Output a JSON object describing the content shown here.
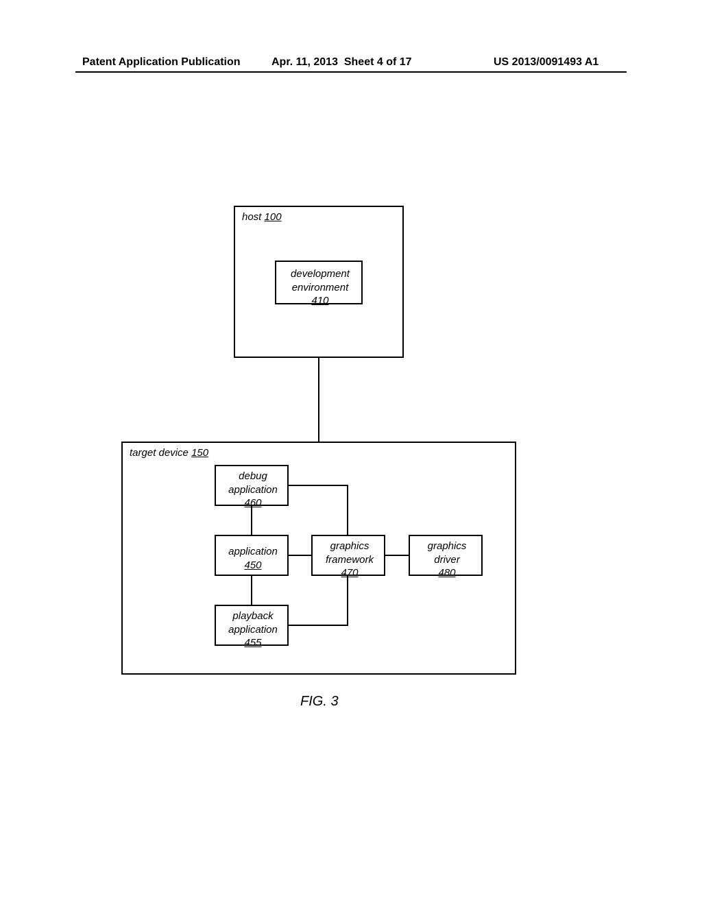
{
  "header": {
    "left": "Patent Application Publication",
    "date": "Apr. 11, 2013",
    "sheet": "Sheet 4 of 17",
    "pubnum": "US 2013/0091493 A1"
  },
  "figure_caption": "FIG. 3",
  "host": {
    "label": "host",
    "ref": "100",
    "dev_env": {
      "label": "development\nenvironment",
      "ref": "410"
    }
  },
  "target": {
    "label": "target device",
    "ref": "150",
    "debug_app": {
      "label": "debug\napplication",
      "ref": "460"
    },
    "application": {
      "label": "application",
      "ref": "450"
    },
    "playback": {
      "label": "playback\napplication",
      "ref": "455"
    },
    "framework": {
      "label": "graphics\nframework",
      "ref": "470"
    },
    "driver": {
      "label": "graphics\ndriver",
      "ref": "480"
    }
  }
}
